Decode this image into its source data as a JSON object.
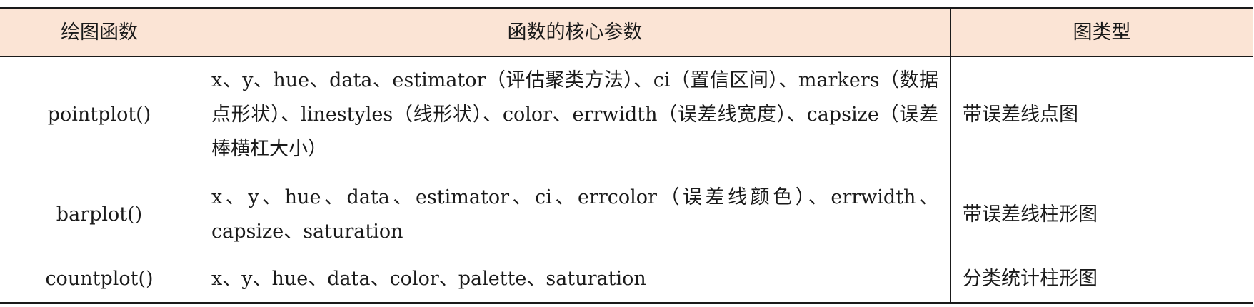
{
  "table": {
    "headers": [
      "绘图函数",
      "函数的核心参数",
      "图类型"
    ],
    "rows": [
      {
        "function": "pointplot()",
        "params": "x、y、hue、data、estimator（评估聚类方法）、ci（置信区间）、markers（数据点形状）、linestyles（线形状）、color、errwidth（误差线宽度）、capsize（误差棒横杠大小）",
        "chart_type": "带误差线点图"
      },
      {
        "function": "barplot()",
        "params": "x、y、hue、data、estimator、ci、errcolor（误差线颜色）、errwidth、capsize、saturation",
        "chart_type": "带误差线柱形图"
      },
      {
        "function": "countplot()",
        "params": "x、y、hue、data、color、palette、saturation",
        "chart_type": "分类统计柱形图"
      }
    ]
  },
  "colors": {
    "header_background": "#fbe4d5",
    "rule": "#1a1a1a"
  }
}
